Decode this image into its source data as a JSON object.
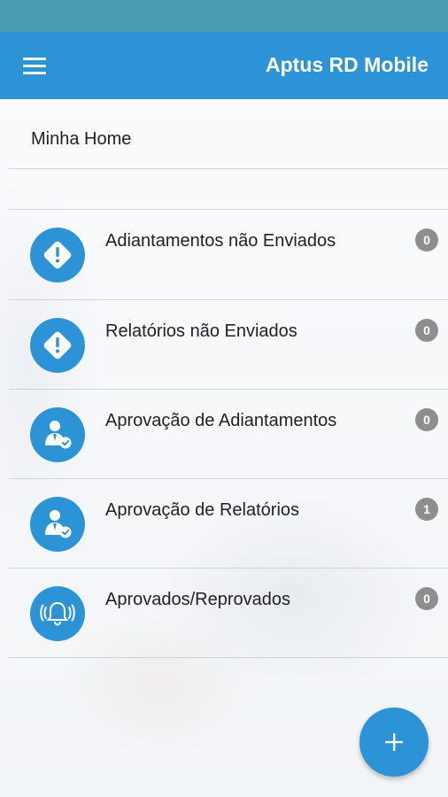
{
  "app": {
    "title": "Aptus RD Mobile"
  },
  "home": {
    "label": "Minha Home"
  },
  "items": [
    {
      "label": "Adiantamentos não Enviados",
      "count": "0",
      "icon": "warning-icon"
    },
    {
      "label": "Relatórios não Enviados",
      "count": "0",
      "icon": "warning-icon"
    },
    {
      "label": "Aprovação de Adiantamentos",
      "count": "0",
      "icon": "user-approve-icon"
    },
    {
      "label": "Aprovação de Relatórios",
      "count": "1",
      "icon": "user-approve-icon"
    },
    {
      "label": "Aprovados/Reprovados",
      "count": "0",
      "icon": "bell-ringing-icon"
    }
  ],
  "fab": {
    "icon": "plus-icon"
  },
  "colors": {
    "primary": "#2c93d6",
    "status_bar": "#4a9cb3",
    "badge": "#8e8e8e"
  }
}
